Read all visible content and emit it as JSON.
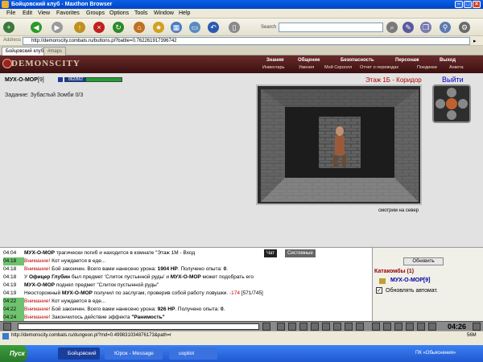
{
  "window": {
    "title": "Бойцовский клуб - Maxthon Browser"
  },
  "menu": [
    "File",
    "Edit",
    "View",
    "Favorites",
    "Groups",
    "Options",
    "Tools",
    "Window",
    "Help"
  ],
  "toolbar": {
    "search_label": "Search"
  },
  "address": {
    "label": "Address",
    "url": "http://demonscity.combats.ru/buttons.pl?battle=0.762261917396742"
  },
  "tabs": [
    "Бойцовский клуб",
    "#maps"
  ],
  "game_nav": {
    "brand": "DEMONSCITY",
    "top": [
      "Знания",
      "Общение",
      "Безопасность",
      "Персонаж",
      "Выход"
    ],
    "sub": [
      "Инвентарь",
      "Умения",
      "Мой Скроллл",
      "Отчет о переводах",
      "Поединки",
      "Анкета"
    ]
  },
  "character": {
    "name": "МУХ-О-МОР",
    "level": "[9]",
    "hp": "862/862",
    "hp_fraction": 1.0
  },
  "task": "Задание: Зубастый Зомби 0/3",
  "location": {
    "name": "Этаж 1Б - Коридор",
    "exit": "Выйти",
    "direction": "смотрим на север"
  },
  "chat": {
    "tabs": [
      "Чат",
      "Системные сообщения"
    ],
    "lines": [
      {
        "time": "04:04",
        "green": false,
        "parts": [
          {
            "t": "МУХ-О-МОР",
            "b": true
          },
          {
            "t": " трагически погиб и находится в комнате \"Этаж 1М - Вход"
          }
        ]
      },
      {
        "time": "04:18",
        "green": true,
        "parts": [
          {
            "t": "Внимание!",
            "r": true
          },
          {
            "t": " Кот нуждается в еде..."
          }
        ]
      },
      {
        "time": "04:18",
        "green": false,
        "parts": [
          {
            "t": "Внимание!",
            "r": true
          },
          {
            "t": " Бой закончен. Всего вами нанесено урона: "
          },
          {
            "t": "1904 HP",
            "b": true
          },
          {
            "t": ". Получено опыта: "
          },
          {
            "t": "0",
            "b": true
          },
          {
            "t": "."
          }
        ]
      },
      {
        "time": "04:18",
        "green": false,
        "parts": [
          {
            "t": "У "
          },
          {
            "t": "Офицер Глубин",
            "b": true
          },
          {
            "t": " был предмет 'Слиток пустынной руды' и "
          },
          {
            "t": "МУХ-О-МОР",
            "b": true
          },
          {
            "t": " может подобрать его"
          }
        ]
      },
      {
        "time": "04:19",
        "green": false,
        "parts": [
          {
            "t": "МУХ-О-МОР",
            "b": true
          },
          {
            "t": " поднял предмет \"Слиток пустынной руды\""
          }
        ]
      },
      {
        "time": "04:19",
        "green": false,
        "parts": [
          {
            "t": "Неосторожный "
          },
          {
            "t": "МУХ-О-МОР",
            "b": true
          },
          {
            "t": " получил по заслугам, проверив собой работу ловушки. "
          },
          {
            "t": "-174",
            "r": true
          },
          {
            "t": " [571/745]"
          }
        ]
      },
      {
        "time": "04:22",
        "green": true,
        "parts": [
          {
            "t": "Внимание!",
            "r": true
          },
          {
            "t": " Кот нуждается в еде..."
          }
        ]
      },
      {
        "time": "04:22",
        "green": true,
        "parts": [
          {
            "t": "Внимание!",
            "r": true
          },
          {
            "t": " Бой закончен. Всего вами нанесено урона: "
          },
          {
            "t": "926 HP",
            "b": true
          },
          {
            "t": ". Получено опыта: "
          },
          {
            "t": "0",
            "b": true
          },
          {
            "t": "."
          }
        ]
      },
      {
        "time": "04:24",
        "green": true,
        "parts": [
          {
            "t": "Внимание!",
            "r": true
          },
          {
            "t": " Закончилось действие эффекта "
          },
          {
            "t": "\"Ранимость\"",
            "b": true
          }
        ]
      }
    ]
  },
  "side": {
    "refresh": "Обновить",
    "catacombs": "Катакомбы (1)",
    "member": "МУХ-О-МОР[9]",
    "auto": "Обновлять автомат."
  },
  "clock": "04:26",
  "status": {
    "url": "http://demonscity.combats.ru/dungeon.pl?md=0.499831034876173&path=r",
    "size": "56M"
  },
  "taskbar": {
    "start": "Пуск",
    "tasks": [
      "Бойцовский клуб - M...",
      "Юрок - Message",
      "uopilot"
    ],
    "tray": "ПК «Обьяснения»"
  }
}
